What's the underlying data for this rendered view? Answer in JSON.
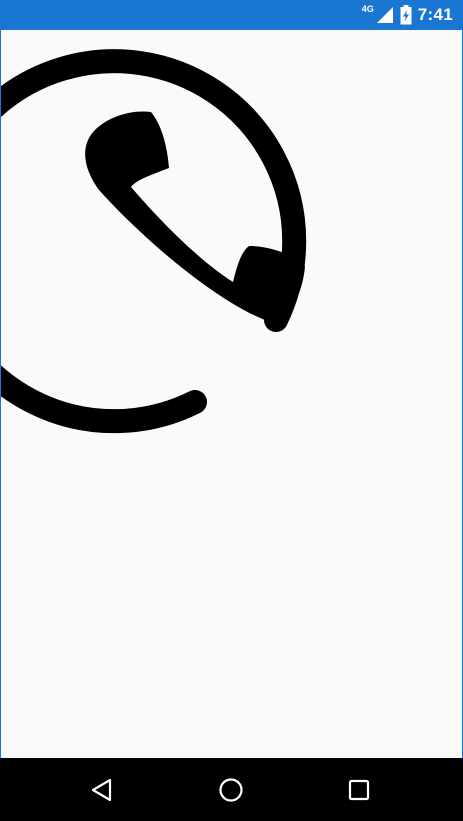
{
  "status_bar": {
    "network_type": "4G",
    "time": "7:41",
    "icons": [
      "signal-icon",
      "battery-icon"
    ]
  },
  "content": {
    "icon": "phone-in-circle-icon"
  },
  "nav_bar": {
    "buttons": [
      "back-icon",
      "home-icon",
      "recents-icon"
    ]
  },
  "colors": {
    "status_bar": "#1976d2",
    "background": "#fafafa",
    "nav_bar": "#000000",
    "icon": "#000000"
  }
}
